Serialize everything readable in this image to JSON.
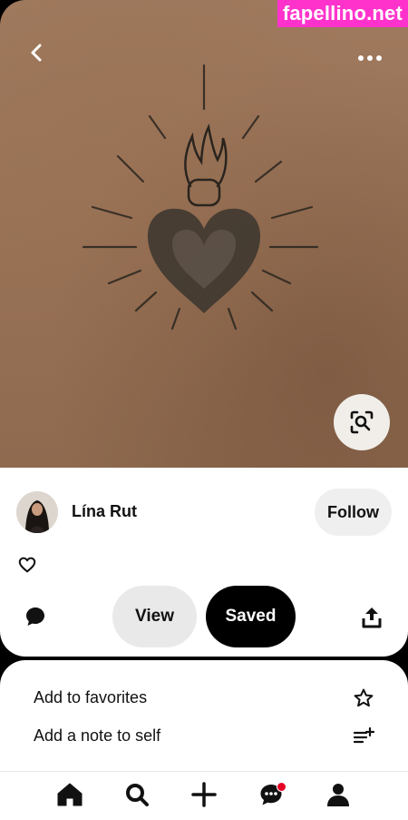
{
  "watermark": {
    "text": "fapellino.net",
    "color": "#ff33cc"
  },
  "pin": {
    "image_description": "dotwork sacred heart tattoo with flames and rays on skin",
    "back_icon": "chevron-left-icon",
    "more_icon": "more-horizontal-icon",
    "lens_icon": "visual-search-icon"
  },
  "creator": {
    "name": "Lína Rut",
    "follow_label": "Follow"
  },
  "actions": {
    "like_icon": "heart-outline-icon",
    "comment_icon": "comment-icon",
    "view_label": "View",
    "saved_label": "Saved",
    "share_icon": "share-icon"
  },
  "options": [
    {
      "label": "Add to favorites",
      "icon": "star-outline-icon"
    },
    {
      "label": "Add a note to self",
      "icon": "note-add-icon"
    }
  ],
  "tabbar": {
    "tabs": [
      "home-icon",
      "search-icon",
      "create-icon",
      "messages-icon",
      "profile-icon"
    ],
    "notification_color": "#e60023"
  }
}
